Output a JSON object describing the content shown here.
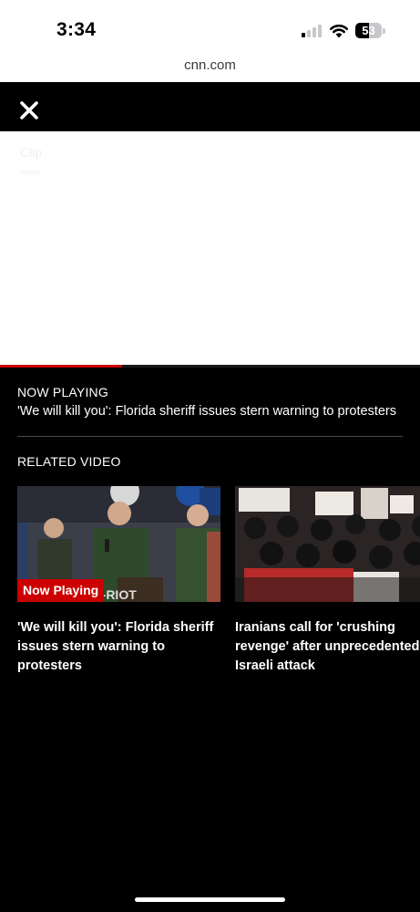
{
  "status_bar": {
    "time": "3:34",
    "battery_level": "53",
    "signal_bars_active": 1,
    "signal_bars_total": 4
  },
  "browser": {
    "url": "cnn.com"
  },
  "player": {
    "close_icon": "close-icon",
    "faint_title": "Clip",
    "faint_subtitle": "views",
    "progress": 0.29,
    "progress_color": "#cc0000"
  },
  "now_playing": {
    "label": "NOW PLAYING",
    "title": "'We will kill you': Florida sheriff issues stern warning to protesters"
  },
  "related": {
    "label": "RELATED VIDEO",
    "items": [
      {
        "badge": "Now Playing",
        "title_lines": [
          "'We will kill you': Florida sheriff",
          "issues stern warning to",
          "protesters"
        ],
        "thumbnail": "sheriff-press-conference-thumbnail"
      },
      {
        "badge": "",
        "title_lines": [
          "Iranians call for 'crushing",
          "revenge' after unprecedented",
          "Israeli attack"
        ],
        "thumbnail": "iran-protest-thumbnail"
      }
    ]
  },
  "colors": {
    "accent": "#cc0000",
    "background": "#000000"
  }
}
